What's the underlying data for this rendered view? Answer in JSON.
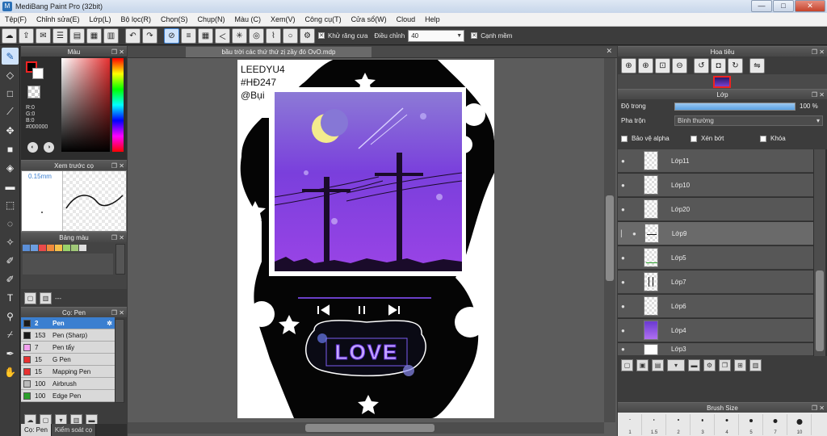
{
  "app": {
    "title": "MediBang Paint Pro (32bit)",
    "min": "—",
    "max": "□",
    "close": "✕"
  },
  "menu": [
    "Tệp(F)",
    "Chỉnh sửa(E)",
    "Lớp(L)",
    "Bộ lọc(R)",
    "Chọn(S)",
    "Chụp(N)",
    "Màu (C)",
    "Xem(V)",
    "Công cụ(T)",
    "Cửa sổ(W)",
    "Cloud",
    "Help"
  ],
  "toolbar": {
    "antialias_label": "Khử răng cưa",
    "adjust_label": "Điều chỉnh",
    "adjust_value": "40",
    "smooth_label": "Cạnh mềm"
  },
  "color_panel": {
    "title": "Màu",
    "r": "R:0",
    "g": "G:0",
    "b": "B:0",
    "hex": "#000000",
    "fg": "#000000",
    "bg": "#ffffff"
  },
  "brush_preview": {
    "title": "Xem trước cọ",
    "size": "0.15mm"
  },
  "palette": {
    "title": "Bảng màu",
    "colors": [
      "#5b8fd8",
      "#6c9ee0",
      "#ea4a4a",
      "#f08a3a",
      "#f5c04a",
      "#9ad36a",
      "#a0c878",
      "#e0e0e0"
    ],
    "footer": "---"
  },
  "brush_panel": {
    "title": "Cọ: Pen",
    "items": [
      {
        "size": "2",
        "name": "Pen",
        "color": "#1a1a1a"
      },
      {
        "size": "153",
        "name": "Pen (Sharp)",
        "color": "#1a1a1a"
      },
      {
        "size": "7",
        "name": "Pen tẩy",
        "color": "#f4a0f0"
      },
      {
        "size": "15",
        "name": "G Pen",
        "color": "#e83030"
      },
      {
        "size": "15",
        "name": "Mapping Pen",
        "color": "#e83030"
      },
      {
        "size": "100",
        "name": "Airbrush",
        "color": "#bbbbbb"
      },
      {
        "size": "100",
        "name": "Edge Pen",
        "color": "#2aa02a"
      }
    ],
    "tabs": [
      "Cọ: Pen",
      "Kiểm soát cọ"
    ]
  },
  "document": {
    "tab_title": "bầu trời các thứ thứ zị zầy đó OvO.mdp",
    "signature_line1": "LEEDYU4",
    "signature_line2": "#HĐ247",
    "signature_line3": "@Bụi",
    "love_text": "LOVE"
  },
  "navigator": {
    "title": "Hoa tiêu"
  },
  "layer_panel": {
    "title": "Lớp",
    "opacity_label": "Độ trong",
    "opacity_value": "100 %",
    "opacity_fraction": 1.0,
    "blend_label": "Pha trộn",
    "blend_value": "Bình thường",
    "protect_alpha": "Bảo vệ alpha",
    "clipping": "Xén bớt",
    "lock": "Khóa",
    "layers": [
      "Lớp11",
      "Lớp10",
      "Lớp20",
      "Lớp9",
      "Lớp5",
      "Lớp7",
      "Lớp6",
      "Lớp4",
      "Lớp3"
    ]
  },
  "brush_size": {
    "title": "Brush Size",
    "sizes": [
      "1",
      "1.5",
      "2",
      "3",
      "4",
      "5",
      "7",
      "10"
    ]
  }
}
